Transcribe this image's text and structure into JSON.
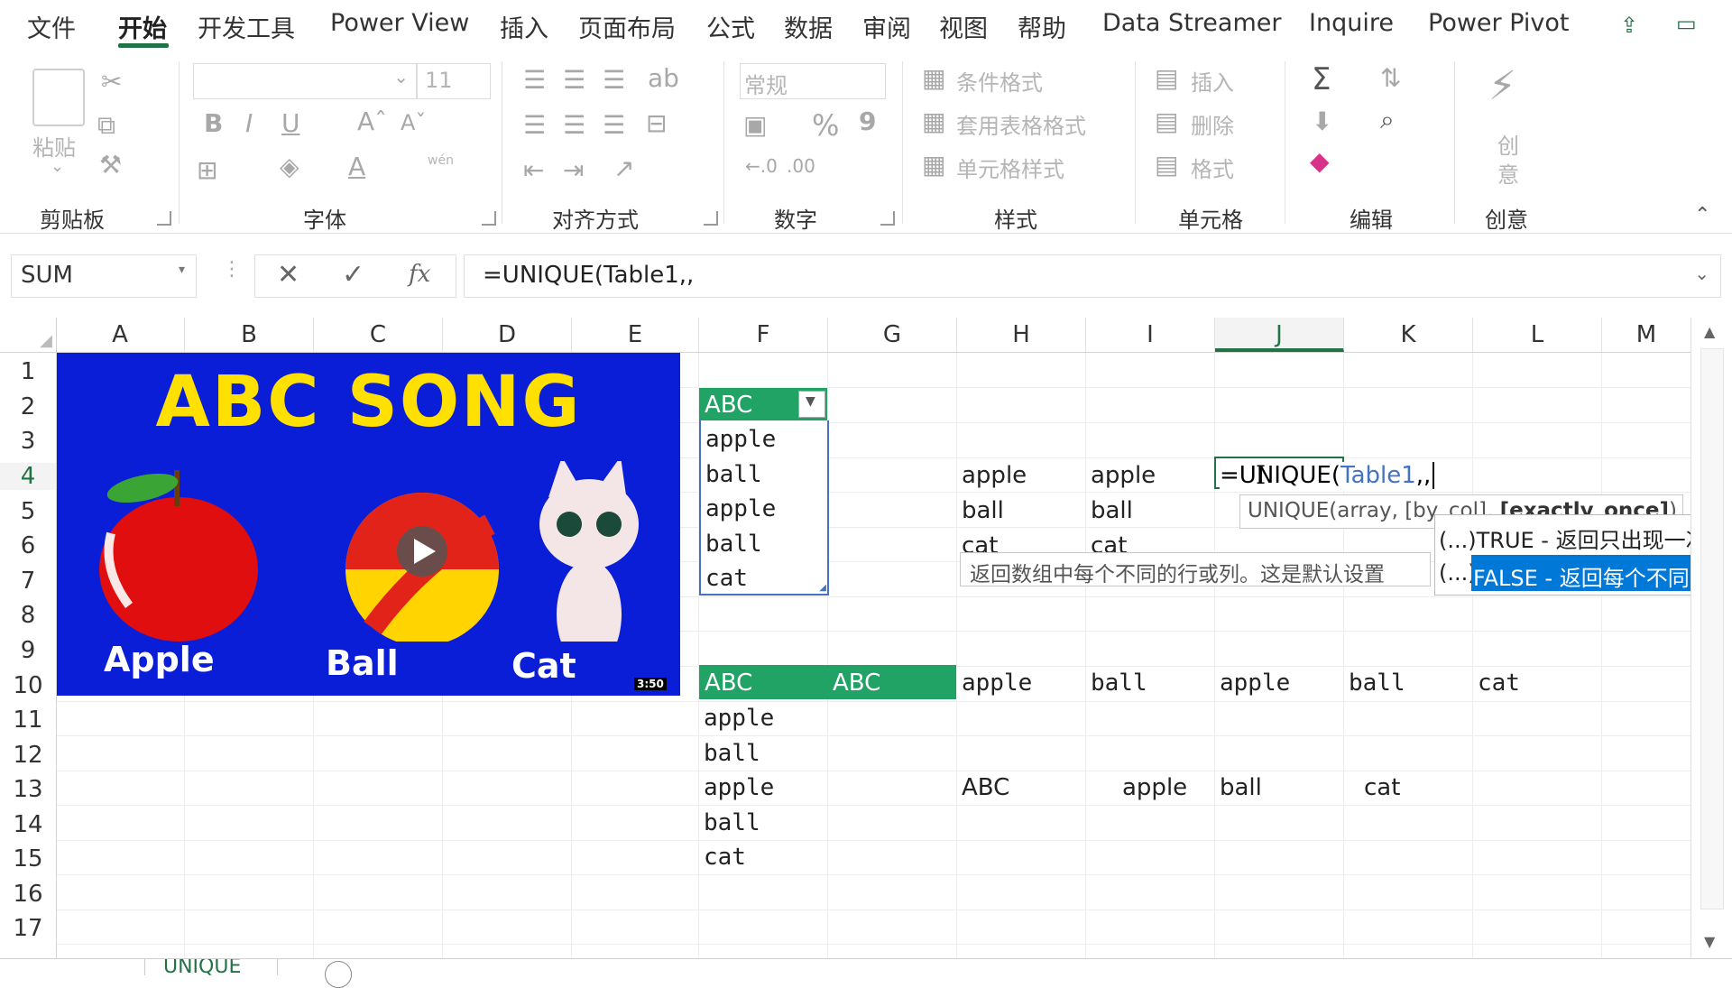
{
  "tabs": {
    "file": "文件",
    "home": "开始",
    "developer": "开发工具",
    "powerview": "Power View",
    "insert": "插入",
    "layout": "页面布局",
    "formulas": "公式",
    "data": "数据",
    "review": "审阅",
    "view": "视图",
    "help": "帮助",
    "datastreamer": "Data Streamer",
    "inquire": "Inquire",
    "powerpivot": "Power Pivot"
  },
  "ribbon": {
    "clipboard": {
      "label": "剪贴板",
      "paste": "粘贴"
    },
    "font": {
      "label": "字体",
      "size": "11",
      "bold": "B",
      "italic": "I",
      "underline": "U",
      "wen": "wén"
    },
    "alignment": {
      "label": "对齐方式"
    },
    "number": {
      "label": "数字",
      "format": "常规",
      "percent": "%",
      "comma": "9"
    },
    "styles": {
      "label": "样式",
      "conditional": "条件格式",
      "table": "套用表格格式",
      "cell": "单元格样式"
    },
    "cells": {
      "label": "单元格",
      "insert": "插入",
      "delete": "删除",
      "format": "格式"
    },
    "editing": {
      "label": "编辑"
    },
    "ideas": {
      "label": "创意",
      "text1": "创",
      "text2": "意"
    }
  },
  "formula_bar": {
    "name_box": "SUM",
    "formula": "=UNIQUE(Table1,,",
    "fx": "fx"
  },
  "columns": [
    "A",
    "B",
    "C",
    "D",
    "E",
    "F",
    "G",
    "H",
    "I",
    "J",
    "K",
    "L",
    "M"
  ],
  "rows": [
    "1",
    "2",
    "3",
    "4",
    "5",
    "6",
    "7",
    "8",
    "9",
    "10",
    "11",
    "12",
    "13",
    "14",
    "15",
    "16",
    "17"
  ],
  "thumbnail": {
    "title": "ABC SONG",
    "apple": "Apple",
    "ball": "Ball",
    "cat": "Cat",
    "duration": "3:50"
  },
  "table1": {
    "header": "ABC",
    "items": [
      "apple",
      "ball",
      "apple",
      "ball",
      "cat"
    ]
  },
  "h_col": [
    "apple",
    "ball",
    "cat"
  ],
  "i_col": [
    "apple",
    "ball",
    "cat"
  ],
  "j4_formula": {
    "prefix": "=UNIQUE(",
    "ref": "Table1",
    "suffix": ",,"
  },
  "tips": {
    "syntax_prefix": "UNIQUE(array, [by_col], ",
    "syntax_bold": "[exactly_once]",
    "syntax_suffix": ")",
    "description": "返回数组中每个不同的行或列。这是默认设置",
    "opt_true": "(...)TRUE - 返回只出现一次",
    "opt_false_prefix": "(...)",
    "opt_false": "FALSE - 返回每个不同的"
  },
  "row10": {
    "f_header": "ABC",
    "g_header": "ABC",
    "values": [
      "apple",
      "ball",
      "apple",
      "ball",
      "cat"
    ]
  },
  "f_list2": [
    "apple",
    "ball",
    "apple",
    "ball",
    "cat"
  ],
  "row13": [
    "ABC",
    "apple",
    "ball",
    "cat"
  ],
  "sheet_tab": "UNIQUE"
}
